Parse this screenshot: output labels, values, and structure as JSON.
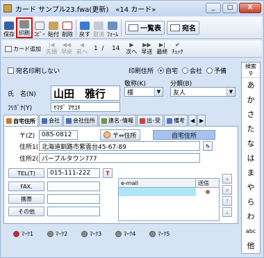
{
  "window": {
    "title": "カード サンプル23.fwa(更新)　«14 カード»",
    "buttons": {
      "minimize": "_",
      "maximize": "□",
      "close": "X"
    }
  },
  "toolbar": {
    "save": "保存",
    "print": "印刷",
    "copy": "ｺﾋﾟｰ",
    "paste": "貼付",
    "delete": "削除",
    "undo": "戻す",
    "cancel": "取消",
    "form": "ﾌｫｰﾑ",
    "list": "一覧表",
    "address": "宛名"
  },
  "nav": {
    "card_add": "カード追加",
    "first": "先頭",
    "rewind": "早戻",
    "prev": "前へ",
    "page_current": "1",
    "page_total": "14",
    "next": "次へ",
    "forward": "早送",
    "last": "最終",
    "check": "ﾁｪｯｸ"
  },
  "form": {
    "no_print_label": "宛名印刷しない",
    "print_address_label": "印刷住所",
    "print_address_options": [
      "自宅",
      "会社",
      "予備"
    ],
    "print_address_selected": "自宅",
    "name_label": "氏　名(N)",
    "name_value": "山田　雅行",
    "furigana_label": "ﾌﾘｶﾞﾅ(Y)",
    "furigana_value": "ﾔﾏﾀﾞ ﾏｻﾕｷ",
    "honorific_label": "敬称(K)",
    "honorific_value": "様",
    "category_label": "分類(B)",
    "category_value": "友人"
  },
  "tabs": [
    "自宅住所",
    "会社",
    "会社住所",
    "連名･情報",
    "出･受",
    "備考"
  ],
  "address": {
    "zip_label": "〒(Z)",
    "zip_value": "085-0812",
    "zip_button": "〒⇔住所",
    "type_label": "自宅住所",
    "addr1_label": "住所1(1)",
    "addr1_value": "北海道釧路市紫雲台45-67-89",
    "addr2_label": "住所2(2)",
    "addr2_value": "パープルタウン777"
  },
  "phones": {
    "tel_label": "TEL(T)",
    "tel_value": "015-111-222",
    "fax_label": "FAX.",
    "mobile_label": "携帯",
    "other_label": "その他"
  },
  "email": {
    "col_email": "e-mail",
    "col_send": "送信"
  },
  "marks": [
    {
      "label": "ﾏｰｸ1",
      "color": "#e02020"
    },
    {
      "label": "ﾏｰｸ2",
      "color": "#8a8a8a"
    },
    {
      "label": "ﾏｰｸ3",
      "color": "#8a8a8a"
    },
    {
      "label": "ﾏｰｸ4",
      "color": "#8a8a8a"
    },
    {
      "label": "ﾏｰｸ5",
      "color": "#8a8a8a"
    }
  ],
  "index": {
    "header": "検索",
    "items": [
      "あ",
      "か",
      "さ",
      "た",
      "な",
      "は",
      "ま",
      "や",
      "ら",
      "わ",
      "abc",
      "他"
    ]
  }
}
